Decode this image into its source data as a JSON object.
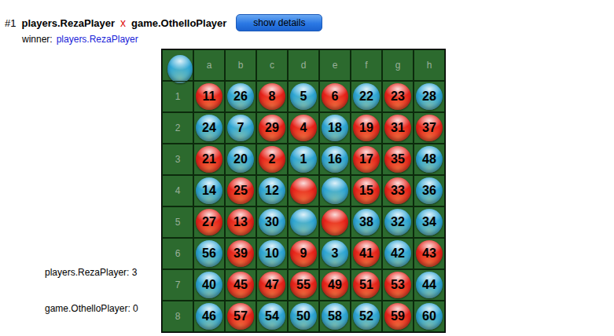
{
  "match": {
    "number": "#1",
    "player1": "players.RezaPlayer",
    "versus": "x",
    "player2": "game.OthelloPlayer"
  },
  "button": "show details",
  "winner": {
    "label": "winner:",
    "name": "players.RezaPlayer"
  },
  "scores": [
    {
      "text": "players.RezaPlayer: 3"
    },
    {
      "text": "game.OthelloPlayer: 0"
    }
  ],
  "board": {
    "turn": {
      "color": "#2ea7d6"
    },
    "columns": [
      "a",
      "b",
      "c",
      "d",
      "e",
      "f",
      "g",
      "h"
    ],
    "rows": [
      {
        "label": "1",
        "cells": [
          {
            "color": "#e8231a",
            "number": "11"
          },
          {
            "color": "#2ea7d6",
            "number": "26"
          },
          {
            "color": "#e8231a",
            "number": "8"
          },
          {
            "color": "#2ea7d6",
            "number": "5"
          },
          {
            "color": "#e8231a",
            "number": "6"
          },
          {
            "color": "#2ea7d6",
            "number": "22"
          },
          {
            "color": "#e8231a",
            "number": "23"
          },
          {
            "color": "#2ea7d6",
            "number": "28"
          }
        ]
      },
      {
        "label": "2",
        "cells": [
          {
            "color": "#2ea7d6",
            "number": "24"
          },
          {
            "color": "#2ea7d6",
            "number": "7"
          },
          {
            "color": "#e8231a",
            "number": "29"
          },
          {
            "color": "#e8231a",
            "number": "4"
          },
          {
            "color": "#2ea7d6",
            "number": "18"
          },
          {
            "color": "#e8231a",
            "number": "19"
          },
          {
            "color": "#e8231a",
            "number": "31"
          },
          {
            "color": "#e8231a",
            "number": "37"
          }
        ]
      },
      {
        "label": "3",
        "cells": [
          {
            "color": "#e8231a",
            "number": "21"
          },
          {
            "color": "#2ea7d6",
            "number": "20"
          },
          {
            "color": "#e8231a",
            "number": "2"
          },
          {
            "color": "#2ea7d6",
            "number": "1"
          },
          {
            "color": "#2ea7d6",
            "number": "16"
          },
          {
            "color": "#e8231a",
            "number": "17"
          },
          {
            "color": "#e8231a",
            "number": "35"
          },
          {
            "color": "#2ea7d6",
            "number": "48"
          }
        ]
      },
      {
        "label": "4",
        "cells": [
          {
            "color": "#2ea7d6",
            "number": "14"
          },
          {
            "color": "#e8231a",
            "number": "25"
          },
          {
            "color": "#2ea7d6",
            "number": "12"
          },
          {
            "color": "#e8231a",
            "number": ""
          },
          {
            "color": "#2ea7d6",
            "number": ""
          },
          {
            "color": "#e8231a",
            "number": "15"
          },
          {
            "color": "#e8231a",
            "number": "33"
          },
          {
            "color": "#2ea7d6",
            "number": "36"
          }
        ]
      },
      {
        "label": "5",
        "cells": [
          {
            "color": "#e8231a",
            "number": "27"
          },
          {
            "color": "#e8231a",
            "number": "13"
          },
          {
            "color": "#2ea7d6",
            "number": "30"
          },
          {
            "color": "#2ea7d6",
            "number": ""
          },
          {
            "color": "#e8231a",
            "number": ""
          },
          {
            "color": "#2ea7d6",
            "number": "38"
          },
          {
            "color": "#2ea7d6",
            "number": "32"
          },
          {
            "color": "#2ea7d6",
            "number": "34"
          }
        ]
      },
      {
        "label": "6",
        "cells": [
          {
            "color": "#2ea7d6",
            "number": "56"
          },
          {
            "color": "#e8231a",
            "number": "39"
          },
          {
            "color": "#2ea7d6",
            "number": "10"
          },
          {
            "color": "#e8231a",
            "number": "9"
          },
          {
            "color": "#2ea7d6",
            "number": "3"
          },
          {
            "color": "#e8231a",
            "number": "41"
          },
          {
            "color": "#2ea7d6",
            "number": "42"
          },
          {
            "color": "#e8231a",
            "number": "43"
          }
        ]
      },
      {
        "label": "7",
        "cells": [
          {
            "color": "#2ea7d6",
            "number": "40"
          },
          {
            "color": "#e8231a",
            "number": "45"
          },
          {
            "color": "#e8231a",
            "number": "47"
          },
          {
            "color": "#e8231a",
            "number": "55"
          },
          {
            "color": "#e8231a",
            "number": "49"
          },
          {
            "color": "#e8231a",
            "number": "51"
          },
          {
            "color": "#e8231a",
            "number": "53"
          },
          {
            "color": "#2ea7d6",
            "number": "44"
          }
        ]
      },
      {
        "label": "8",
        "cells": [
          {
            "color": "#2ea7d6",
            "number": "46"
          },
          {
            "color": "#e8231a",
            "number": "57"
          },
          {
            "color": "#2ea7d6",
            "number": "54"
          },
          {
            "color": "#2ea7d6",
            "number": "50"
          },
          {
            "color": "#2ea7d6",
            "number": "58"
          },
          {
            "color": "#2ea7d6",
            "number": "52"
          },
          {
            "color": "#e8231a",
            "number": "59"
          },
          {
            "color": "#2ea7d6",
            "number": "60"
          }
        ]
      }
    ]
  }
}
